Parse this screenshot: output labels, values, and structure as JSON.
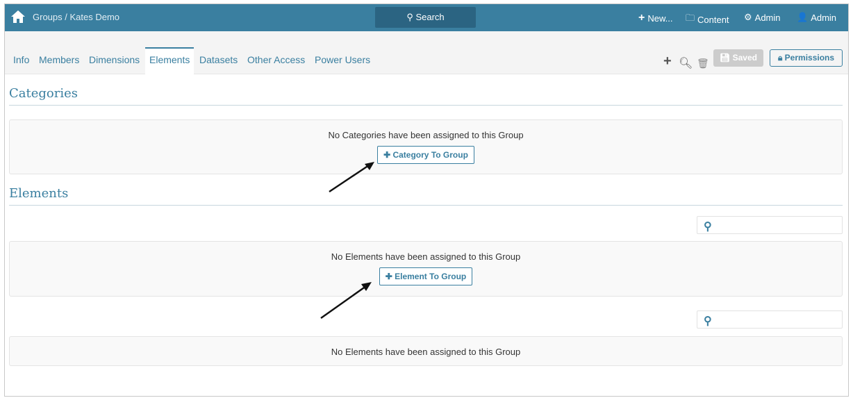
{
  "header": {
    "breadcrumb": "Groups / Kates Demo",
    "search_label": "Search",
    "new_label": "New...",
    "content_label": "Content",
    "admin_label": "Admin",
    "user_label": "Admin"
  },
  "tabs": [
    {
      "label": "Info"
    },
    {
      "label": "Members"
    },
    {
      "label": "Dimensions"
    },
    {
      "label": "Elements"
    },
    {
      "label": "Datasets"
    },
    {
      "label": "Other Access"
    },
    {
      "label": "Power Users"
    }
  ],
  "toolbar": {
    "saved_label": "Saved",
    "permissions_label": "Permissions"
  },
  "categories": {
    "title": "Categories",
    "empty_text": "No Categories have been assigned to this Group",
    "add_label": "Category To Group"
  },
  "elements": {
    "title": "Elements",
    "empty_text": "No Elements have been assigned to this Group",
    "add_label": "Element To Group",
    "empty_text_2": "No Elements have been assigned to this Group"
  },
  "colors": {
    "brand": "#3a7fa0"
  }
}
